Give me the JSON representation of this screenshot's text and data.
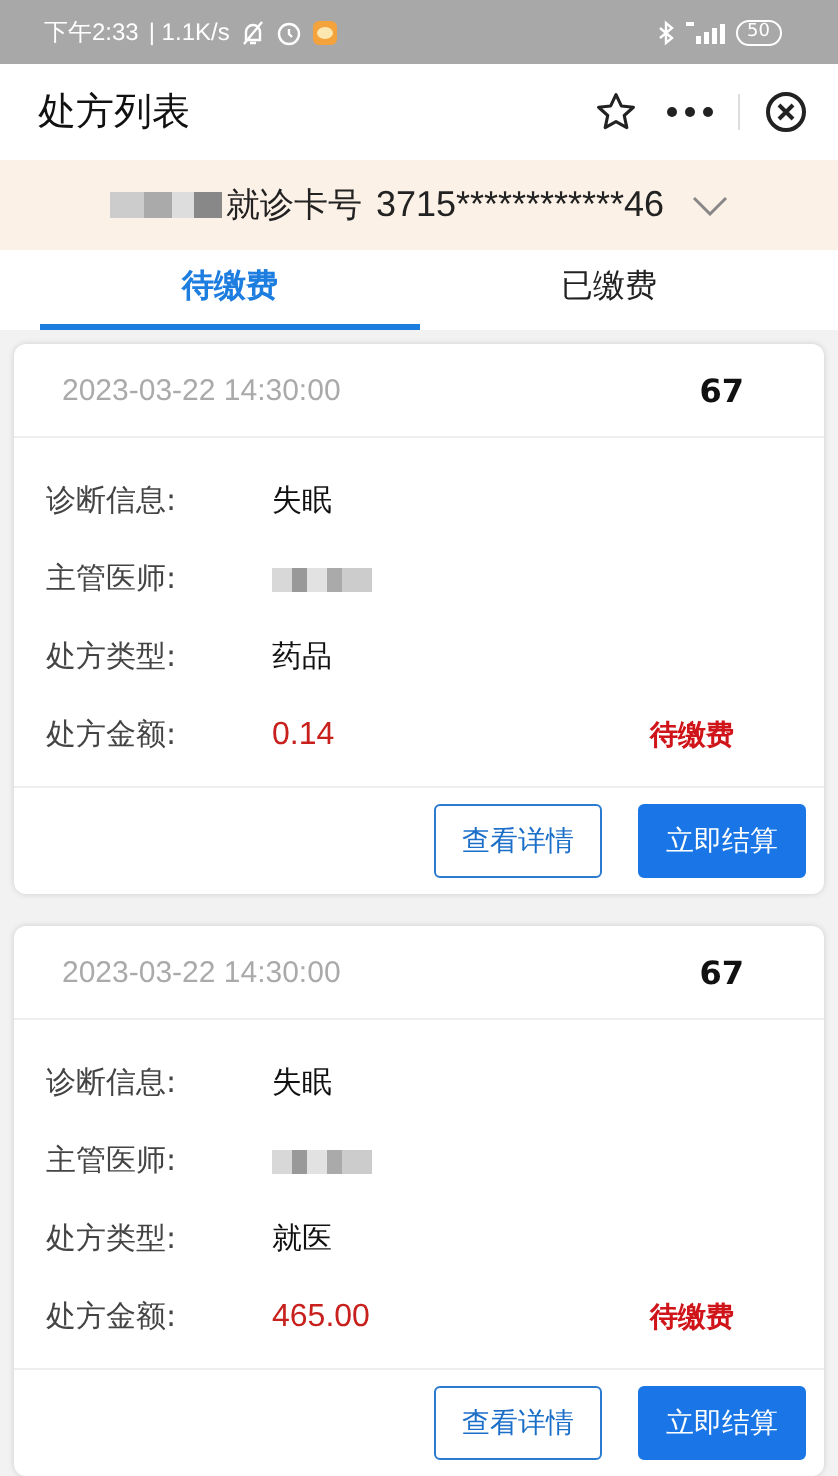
{
  "status_bar": {
    "time": "下午2:33",
    "speed": "| 1.1K/s",
    "battery": "50"
  },
  "nav": {
    "title": "处方列表"
  },
  "patient": {
    "card_label": "就诊卡号",
    "card_number": "3715************46"
  },
  "tabs": [
    {
      "label": "待缴费",
      "selected": true
    },
    {
      "label": "已缴费",
      "selected": false
    }
  ],
  "prescriptions": [
    {
      "datetime": "2023-03-22 14:30:00",
      "number": "67",
      "fields": [
        {
          "label": "诊断信息:",
          "value": "失眠"
        },
        {
          "label": "主管医师:",
          "kind": "blurred"
        },
        {
          "label": "处方类型:",
          "value": "药品"
        },
        {
          "label": "处方金额:",
          "value": "0.14",
          "kind": "amount"
        }
      ],
      "status": "待缴费",
      "buttons": [
        {
          "label": "查看详情",
          "kind": "outline"
        },
        {
          "label": "立即结算",
          "kind": "primary"
        }
      ]
    },
    {
      "datetime": "2023-03-22 14:30:00",
      "number": "67",
      "fields": [
        {
          "label": "诊断信息:",
          "value": "失眠"
        },
        {
          "label": "主管医师:",
          "kind": "blurred"
        },
        {
          "label": "处方类型:",
          "value": "就医"
        },
        {
          "label": "处方金额:",
          "value": "465.00",
          "kind": "amount"
        }
      ],
      "status": "待缴费",
      "buttons": [
        {
          "label": "查看详情",
          "kind": "outline"
        },
        {
          "label": "立即结算",
          "kind": "primary"
        }
      ]
    }
  ]
}
